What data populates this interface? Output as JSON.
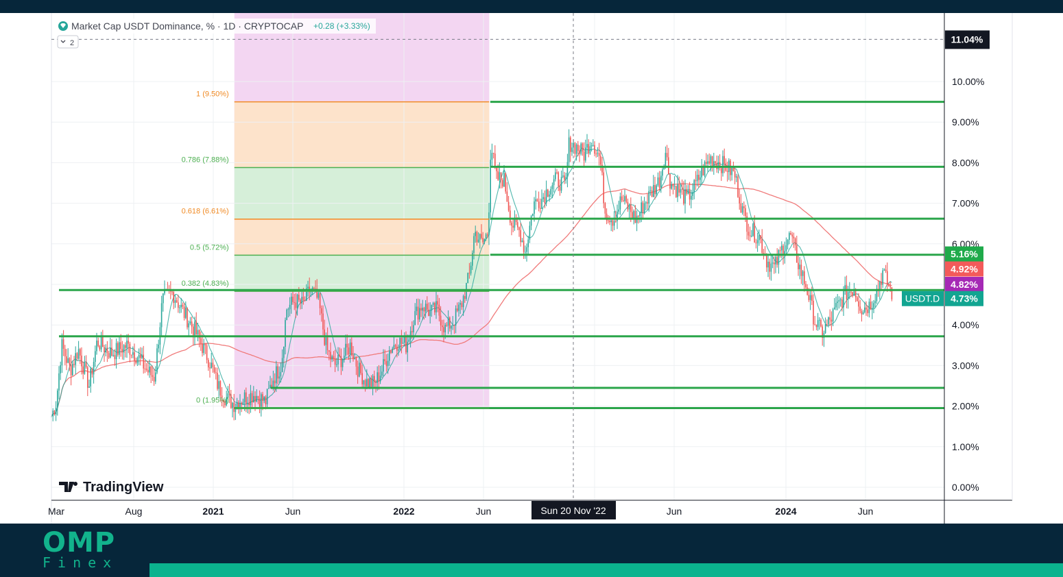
{
  "header": {
    "title": "Market Cap USDT Dominance, % · 1D · CRYPTOCAP",
    "change": "+0.28 (+3.33%)",
    "collapse_label": "2"
  },
  "watermark": {
    "text": "TradingView"
  },
  "brand": {
    "name": "OMP",
    "sub": "Finex"
  },
  "colors": {
    "level_line": "#2aa54a",
    "bull_candle": "#26a69a",
    "bear_candle": "#ef5350",
    "ma_fast": "#26a69a",
    "ma_slow": "#f07a7a",
    "zone_purple": "#f3d6f2",
    "zone_orange": "#fde3cb",
    "zone_green": "#d6efd9",
    "fib_orange": "#f08a24",
    "fib_green": "#4caf50"
  },
  "chart_data": {
    "type": "candlestick",
    "symbol": "USDT.D",
    "timeframe": "1D",
    "ylim": [
      0,
      11.04
    ],
    "ymax_label": "11.04%",
    "y_ticks": [
      "0.00%",
      "1.00%",
      "2.00%",
      "3.00%",
      "4.00%",
      "5.00%",
      "6.00%",
      "7.00%",
      "8.00%",
      "9.00%",
      "10.00%"
    ],
    "x_ticks": [
      "Mar",
      "Aug",
      "2021",
      "Jun",
      "2022",
      "Jun",
      "Sun 20 Nov '22",
      "Jun",
      "2024",
      "Jun"
    ],
    "x_ticks_bold": [
      false,
      false,
      true,
      false,
      true,
      false,
      false,
      false,
      true,
      false
    ],
    "crosshair": {
      "date": "Sun 20 Nov '22",
      "value": "11.04%"
    },
    "horizontal_levels": [
      9.5,
      7.9,
      6.62,
      5.73,
      4.86,
      3.72,
      2.45,
      1.95
    ],
    "fib_retracement": {
      "levels": [
        {
          "label": "1 (9.50%)",
          "value": 9.5,
          "color": "#f08a24"
        },
        {
          "label": "0.786 (7.88%)",
          "value": 7.88,
          "color": "#4caf50"
        },
        {
          "label": "0.618 (6.61%)",
          "value": 6.61,
          "color": "#f08a24"
        },
        {
          "label": "0.5 (5.72%)",
          "value": 5.72,
          "color": "#4caf50"
        },
        {
          "label": "0.382 (4.83%)",
          "value": 4.83,
          "color": "#4caf50"
        },
        {
          "label": "0 (1.95%)",
          "value": 1.95,
          "color": "#4caf50"
        }
      ]
    },
    "price_labels": [
      {
        "text": "5.16%",
        "value": 5.75,
        "color": "#1faa4a"
      },
      {
        "text": "4.92%",
        "value": 5.38,
        "color": "#f35a5a"
      },
      {
        "text": "4.82%",
        "value": 5.0,
        "color": "#a529b5"
      },
      {
        "text": "4.73%",
        "value": 4.65,
        "color": "#12a591",
        "tag": "USDT.D"
      }
    ],
    "price_path": [
      [
        "2020-03-01",
        1.75
      ],
      [
        "2020-03-10",
        2.1
      ],
      [
        "2020-03-20",
        3.5
      ],
      [
        "2020-04-05",
        2.9
      ],
      [
        "2020-04-20",
        3.4
      ],
      [
        "2020-05-10",
        2.5
      ],
      [
        "2020-05-25",
        3.6
      ],
      [
        "2020-06-20",
        3.3
      ],
      [
        "2020-07-20",
        3.5
      ],
      [
        "2020-08-10",
        3.2
      ],
      [
        "2020-08-25",
        2.9
      ],
      [
        "2020-09-10",
        2.7
      ],
      [
        "2020-09-25",
        4.6
      ],
      [
        "2020-10-15",
        4.8
      ],
      [
        "2020-11-05",
        4.3
      ],
      [
        "2020-11-25",
        3.9
      ],
      [
        "2020-12-10",
        3.5
      ],
      [
        "2020-12-25",
        3.1
      ],
      [
        "2021-01-10",
        2.5
      ],
      [
        "2021-01-25",
        2.2
      ],
      [
        "2021-02-10",
        2.05
      ],
      [
        "2021-02-28",
        2.2
      ],
      [
        "2021-03-20",
        2.3
      ],
      [
        "2021-04-10",
        2.1
      ],
      [
        "2021-04-25",
        2.7
      ],
      [
        "2021-05-10",
        3.0
      ],
      [
        "2021-05-20",
        4.4
      ],
      [
        "2021-06-05",
        4.6
      ],
      [
        "2021-06-20",
        4.5
      ],
      [
        "2021-07-05",
        4.9
      ],
      [
        "2021-07-20",
        4.6
      ],
      [
        "2021-08-05",
        3.4
      ],
      [
        "2021-08-20",
        3.0
      ],
      [
        "2021-09-05",
        3.2
      ],
      [
        "2021-09-20",
        3.5
      ],
      [
        "2021-10-05",
        2.9
      ],
      [
        "2021-10-20",
        2.6
      ],
      [
        "2021-11-05",
        2.55
      ],
      [
        "2021-11-20",
        2.9
      ],
      [
        "2021-12-05",
        3.4
      ],
      [
        "2021-12-20",
        3.6
      ],
      [
        "2022-01-05",
        3.5
      ],
      [
        "2022-01-20",
        4.2
      ],
      [
        "2022-02-05",
        4.5
      ],
      [
        "2022-02-20",
        4.3
      ],
      [
        "2022-03-05",
        4.4
      ],
      [
        "2022-03-20",
        3.9
      ],
      [
        "2022-04-05",
        4.1
      ],
      [
        "2022-04-20",
        4.5
      ],
      [
        "2022-05-05",
        5.2
      ],
      [
        "2022-05-15",
        6.3
      ],
      [
        "2022-05-30",
        6.0
      ],
      [
        "2022-06-10",
        6.3
      ],
      [
        "2022-06-15",
        8.5
      ],
      [
        "2022-06-25",
        7.6
      ],
      [
        "2022-07-10",
        7.6
      ],
      [
        "2022-07-25",
        6.5
      ],
      [
        "2022-08-10",
        6.3
      ],
      [
        "2022-08-20",
        5.8
      ],
      [
        "2022-09-05",
        7.0
      ],
      [
        "2022-09-20",
        7.1
      ],
      [
        "2022-10-05",
        7.4
      ],
      [
        "2022-10-20",
        7.6
      ],
      [
        "2022-11-05",
        7.4
      ],
      [
        "2022-11-12",
        8.5
      ],
      [
        "2022-11-25",
        8.4
      ],
      [
        "2022-12-10",
        8.2
      ],
      [
        "2022-12-25",
        8.6
      ],
      [
        "2023-01-10",
        8.1
      ],
      [
        "2023-01-20",
        6.8
      ],
      [
        "2023-02-05",
        6.6
      ],
      [
        "2023-02-20",
        7.1
      ],
      [
        "2023-03-05",
        6.9
      ],
      [
        "2023-03-20",
        6.6
      ],
      [
        "2023-04-05",
        7.0
      ],
      [
        "2023-04-20",
        7.3
      ],
      [
        "2023-05-05",
        7.6
      ],
      [
        "2023-05-15",
        8.3
      ],
      [
        "2023-05-25",
        7.5
      ],
      [
        "2023-06-10",
        7.3
      ],
      [
        "2023-06-25",
        7.1
      ],
      [
        "2023-07-10",
        7.4
      ],
      [
        "2023-07-25",
        7.8
      ],
      [
        "2023-08-10",
        8.1
      ],
      [
        "2023-08-25",
        8.0
      ],
      [
        "2023-09-10",
        7.9
      ],
      [
        "2023-09-25",
        7.7
      ],
      [
        "2023-10-10",
        6.8
      ],
      [
        "2023-10-25",
        6.3
      ],
      [
        "2023-11-10",
        6.2
      ],
      [
        "2023-11-25",
        5.6
      ],
      [
        "2023-12-10",
        5.4
      ],
      [
        "2023-12-25",
        5.9
      ],
      [
        "2024-01-10",
        6.2
      ],
      [
        "2024-01-25",
        5.5
      ],
      [
        "2024-02-10",
        4.9
      ],
      [
        "2024-02-25",
        4.1
      ],
      [
        "2024-03-10",
        3.8
      ],
      [
        "2024-03-25",
        4.1
      ],
      [
        "2024-04-10",
        4.5
      ],
      [
        "2024-04-25",
        4.8
      ],
      [
        "2024-05-10",
        4.9
      ],
      [
        "2024-05-25",
        4.4
      ],
      [
        "2024-06-10",
        4.5
      ],
      [
        "2024-06-25",
        4.9
      ],
      [
        "2024-07-05",
        5.3
      ],
      [
        "2024-07-15",
        5.0
      ],
      [
        "2024-07-25",
        4.73
      ]
    ]
  }
}
